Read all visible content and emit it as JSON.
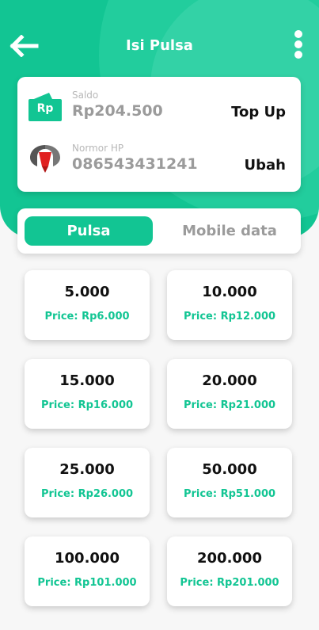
{
  "colors": {
    "accent": "#12c593",
    "white": "#ffffff",
    "muted": "#9b9b9b"
  },
  "header": {
    "title": "Isi Pulsa",
    "back_icon": "arrow-left-icon",
    "menu_icon": "more-vertical-icon"
  },
  "balance_card": {
    "saldo_label": "Saldo",
    "saldo_value": "Rp204.500",
    "rp_badge": "Rp",
    "topup_label": "Top Up",
    "phone_label": "Normor HP",
    "phone_value": "086543431241",
    "change_label": "Ubah"
  },
  "tabs": {
    "active": "Pulsa",
    "inactive": "Mobile data"
  },
  "items": [
    {
      "amount": "5.000",
      "price": "Price: Rp6.000"
    },
    {
      "amount": "10.000",
      "price": "Price: Rp12.000"
    },
    {
      "amount": "15.000",
      "price": "Price: Rp16.000"
    },
    {
      "amount": "20.000",
      "price": "Price: Rp21.000"
    },
    {
      "amount": "25.000",
      "price": "Price: Rp26.000"
    },
    {
      "amount": "50.000",
      "price": "Price: Rp51.000"
    },
    {
      "amount": "100.000",
      "price": "Price: Rp101.000"
    },
    {
      "amount": "200.000",
      "price": "Price: Rp201.000"
    }
  ]
}
